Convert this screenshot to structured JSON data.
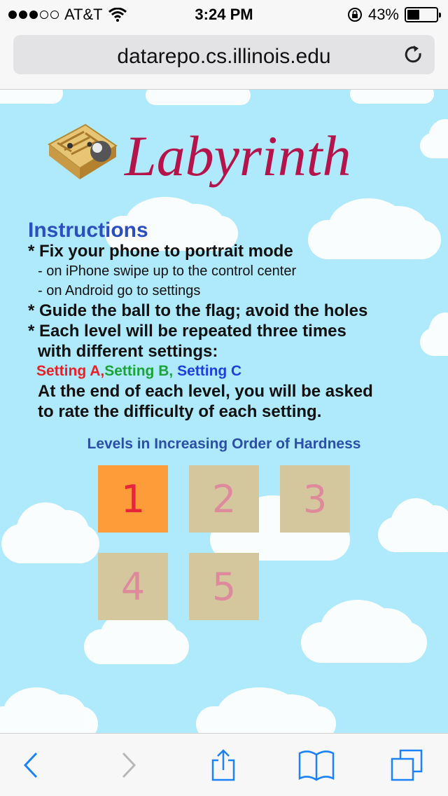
{
  "status_bar": {
    "carrier": "AT&T",
    "time": "3:24 PM",
    "battery_percent": "43%",
    "battery_level": 0.43,
    "signal_bars_filled": 3,
    "signal_bars_total": 5
  },
  "browser": {
    "url": "datarepo.cs.illinois.edu"
  },
  "page": {
    "title": "Labyrinth",
    "instructions": {
      "heading": "Instructions",
      "line1": "* Fix your phone to portrait mode",
      "line2": "- on iPhone swipe up to the control center",
      "line3": "- on Android go to settings",
      "line4": "* Guide the ball to the flag; avoid the holes",
      "line5": "* Each level will be repeated three times",
      "line6": "with different settings:",
      "setting_a": "Setting A,",
      "setting_b": "Setting B, ",
      "setting_c": "Setting C",
      "line7": "At the end of each level, you will be asked",
      "line8": "to rate the difficulty of each setting."
    },
    "levels_heading": "Levels in Increasing Order of Hardness",
    "levels": [
      {
        "label": "1",
        "active": true
      },
      {
        "label": "2",
        "active": false
      },
      {
        "label": "3",
        "active": false
      },
      {
        "label": "4",
        "active": false
      },
      {
        "label": "5",
        "active": false
      }
    ]
  },
  "toolbar": {
    "back_icon": "chevron-left-icon",
    "forward_icon": "chevron-right-icon",
    "share_icon": "share-icon",
    "bookmarks_icon": "book-icon",
    "tabs_icon": "tabs-icon"
  },
  "colors": {
    "sky": "#aeeafc",
    "title": "#b5144a",
    "heading": "#2b4fbf",
    "level_active": "#ff9c3a",
    "level_inactive": "#d4c79e",
    "ios_blue": "#1a82fb"
  }
}
